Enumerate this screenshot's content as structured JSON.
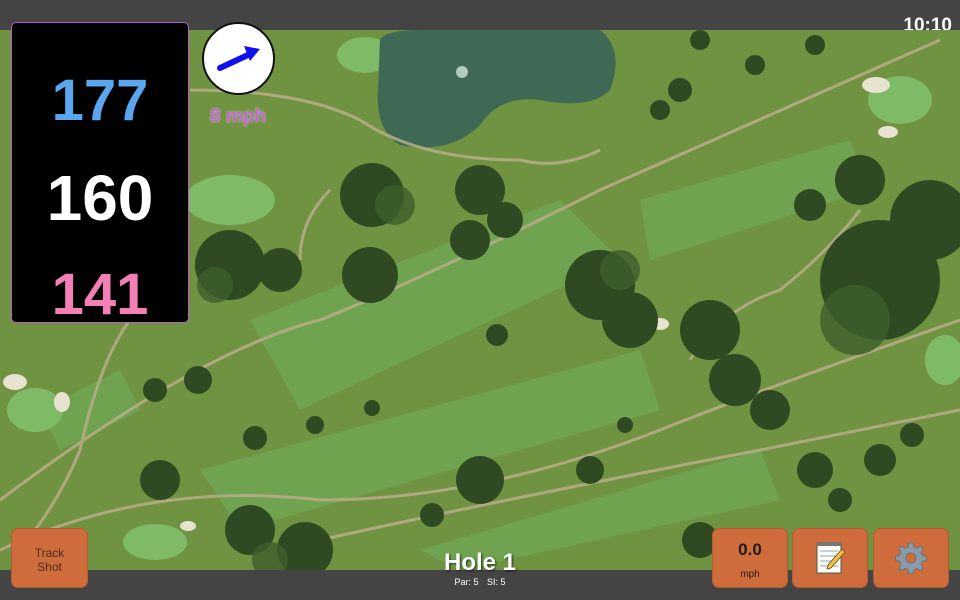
{
  "status_bar": {
    "time": "10:10"
  },
  "distances": {
    "back": "177",
    "middle": "160",
    "front": "141"
  },
  "wind": {
    "speed_label": "8 mph",
    "direction_icon": "arrow-icon"
  },
  "hole": {
    "title": "Hole 1",
    "par_label": "Par: 5",
    "si_label": "SI: 5"
  },
  "buttons": {
    "track_shot_line1": "Track",
    "track_shot_line2": "Shot",
    "wind_value": "0.0",
    "wind_unit": "mph",
    "notes_icon": "notepad-icon",
    "settings_icon": "gear-icon"
  },
  "colors": {
    "back_distance": "#5aa7ef",
    "middle_distance": "#ffffff",
    "front_distance": "#f47fb7",
    "button": "#cf6c3c",
    "wind_text": "#c766d8"
  }
}
